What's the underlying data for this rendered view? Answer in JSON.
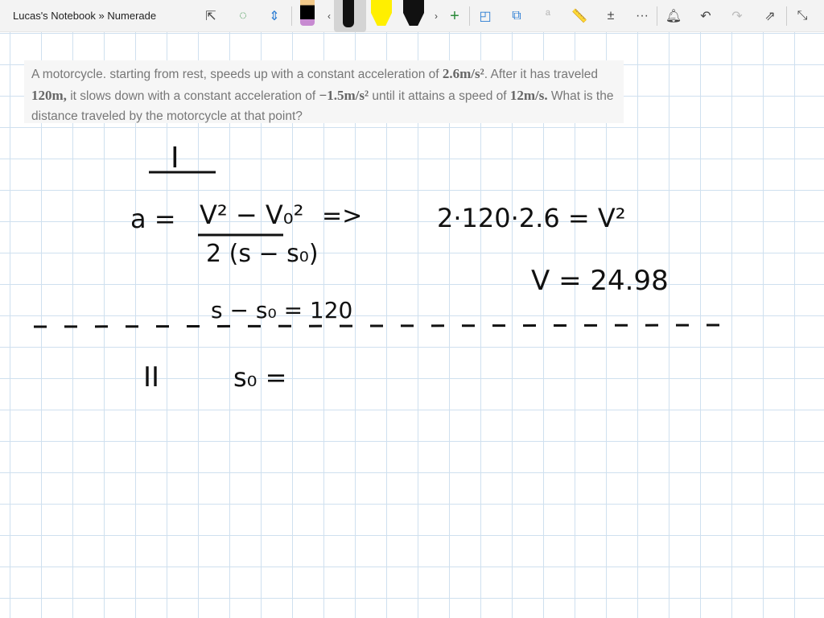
{
  "header": {
    "breadcrumb": "Lucas's Notebook » Numerade"
  },
  "toolbar": {
    "icons": [
      "text-select-icon",
      "lasso-add-icon",
      "insert-space-icon",
      "pen-icon",
      "highlighter-icon",
      "add-pen-icon",
      "shapes-icon",
      "ink-to-shape-icon",
      "ink-to-text-icon",
      "ruler-icon",
      "math-icon",
      "more-icon",
      "bell-icon",
      "undo-icon",
      "redo-icon",
      "share-icon",
      "collapse-icon"
    ],
    "more": "···"
  },
  "problem": {
    "p1": "A motorcycle. starting from rest, speeds up with a constant acceleration of ",
    "v1": "2.6m/s²",
    "p2": ". After it has traveled ",
    "v2": "120m,",
    "p3": " it slows down with a constant acceleration of ",
    "v3": "−1.5m/s²",
    "p4": " until it attains a speed of ",
    "v4": "12m/s.",
    "p5": " What is the distance traveled by the motorcycle at that point?"
  },
  "ink": {
    "part1": "I",
    "eq_lhs": "a =",
    "eq_num": "V² − V₀²",
    "eq_den": "2 (s − s₀)",
    "arrow": "=>",
    "calc": "2·120·2.6 = V²",
    "result": "V = 24.98",
    "delta": "s − s₀ = 120",
    "part2": "II",
    "s0": "s₀ ="
  }
}
